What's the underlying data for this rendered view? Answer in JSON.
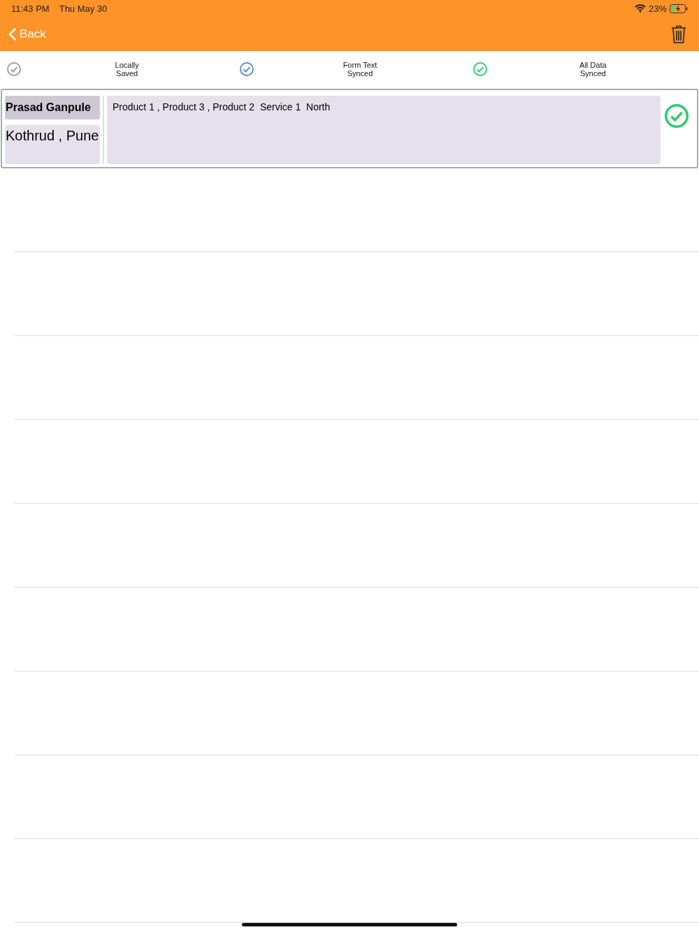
{
  "status_bar": {
    "time": "11:43 PM",
    "date": "Thu May 30",
    "battery": "23%"
  },
  "nav": {
    "back": "Back"
  },
  "legend": [
    {
      "label": "Locally Saved",
      "color": "#a0a0a0"
    },
    {
      "label": "Form Text Synced",
      "color": "#5a8fc8"
    },
    {
      "label": "All Data Synced",
      "color": "#2ecc71"
    }
  ],
  "records": [
    {
      "name": "Prasad Ganpule",
      "location": "Kothrud , Pune",
      "details": "Product 1 , Product 3 , Product 2  Service 1  North",
      "color": "#2ecc71"
    }
  ]
}
